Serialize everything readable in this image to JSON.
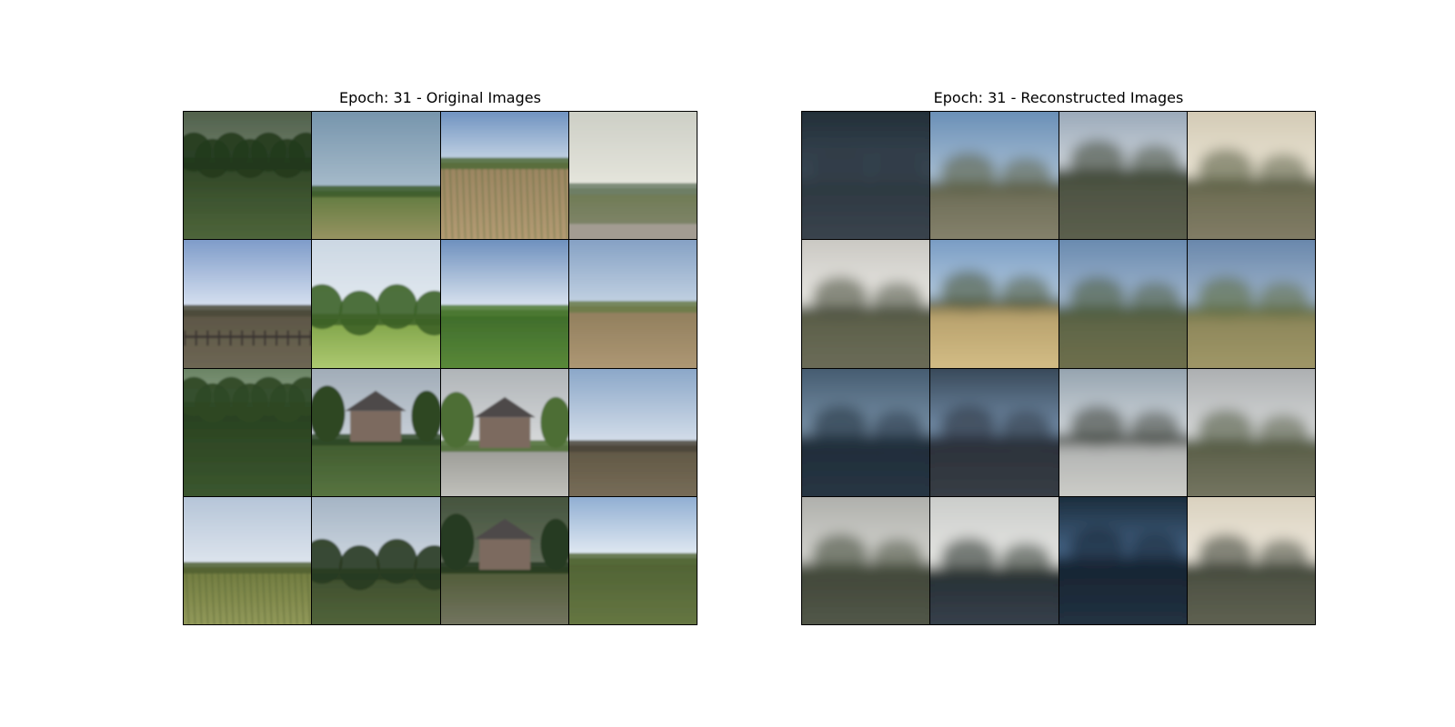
{
  "panels": [
    {
      "title": "Epoch: 31 - Original Images",
      "kind": "original",
      "tiles": [
        {
          "sky": [
            "#4a5a45",
            "#6f7f6a"
          ],
          "horizon": 0.4,
          "ground": [
            "#2f4526",
            "#536b3e"
          ],
          "band": "#243a1e",
          "scene": "woods"
        },
        {
          "sky": [
            "#6f8fa8",
            "#a8bccb"
          ],
          "horizon": 0.62,
          "ground": [
            "#5f7a3e",
            "#a59a6b"
          ],
          "band": "#3c5a2b",
          "scene": "field"
        },
        {
          "sky": [
            "#5b83b8",
            "#c6d5e5"
          ],
          "horizon": 0.4,
          "ground": [
            "#9a8460",
            "#b79f76"
          ],
          "band": "#4f6a37",
          "scene": "cornfield"
        },
        {
          "sky": [
            "#c9cbc2",
            "#e6e6dd"
          ],
          "horizon": 0.6,
          "ground": [
            "#6d7a52",
            "#8b8b78"
          ],
          "band": "#6f7f68",
          "scene": "road"
        },
        {
          "sky": [
            "#6e8fc2",
            "#dbe4f2"
          ],
          "horizon": 0.55,
          "ground": [
            "#5b5545",
            "#716a57"
          ],
          "band": "#4a4a3a",
          "scene": "fence"
        },
        {
          "sky": [
            "#c7d4e0",
            "#e6ecf2"
          ],
          "horizon": 0.62,
          "ground": [
            "#7fa348",
            "#b8d27a"
          ],
          "band": "#3d6228",
          "scene": "trees"
        },
        {
          "sky": [
            "#5a81b5",
            "#dfe7f1"
          ],
          "horizon": 0.55,
          "ground": [
            "#3d6a2a",
            "#5f8f3c"
          ],
          "band": "#4f7a33",
          "scene": "field"
        },
        {
          "sky": [
            "#7a98bf",
            "#c4d3e3"
          ],
          "horizon": 0.52,
          "ground": [
            "#8f7d5c",
            "#b39c78"
          ],
          "band": "#6a7b48",
          "scene": "field"
        },
        {
          "sky": [
            "#5f7a58",
            "#8ea289"
          ],
          "horizon": 0.3,
          "ground": [
            "#28401f",
            "#3e5a31"
          ],
          "band": "#2e4725",
          "scene": "woods"
        },
        {
          "sky": [
            "#9aa6b2",
            "#c8d0d8"
          ],
          "horizon": 0.55,
          "ground": [
            "#3f5a2e",
            "#5d7a45"
          ],
          "band": "#2d4624",
          "scene": "house"
        },
        {
          "sky": [
            "#a9aeb2",
            "#d8dadb"
          ],
          "horizon": 0.6,
          "ground": [
            "#9a9a95",
            "#c9c9c4"
          ],
          "band": "#4e6e34",
          "scene": "house"
        },
        {
          "sky": [
            "#7f9ec3",
            "#d7e0eb"
          ],
          "horizon": 0.6,
          "ground": [
            "#5f5644",
            "#7d725c"
          ],
          "band": "#4a4438",
          "scene": "field"
        },
        {
          "sky": [
            "#aebfd4",
            "#dfe6ee"
          ],
          "horizon": 0.55,
          "ground": [
            "#6f7a3e",
            "#9aa060"
          ],
          "band": "#4f5f30",
          "scene": "cornfield"
        },
        {
          "sky": [
            "#9daec0",
            "#d3dbe3"
          ],
          "horizon": 0.6,
          "ground": [
            "#3e4d2d",
            "#566a3e"
          ],
          "band": "#283a21",
          "scene": "trees"
        },
        {
          "sky": [
            "#3f4f38",
            "#66705e"
          ],
          "horizon": 0.55,
          "ground": [
            "#4f5a36",
            "#7a7a68"
          ],
          "band": "#263a20",
          "scene": "house"
        },
        {
          "sky": [
            "#7fa2cc",
            "#e6edf4"
          ],
          "horizon": 0.48,
          "ground": [
            "#4f6234",
            "#6a7a45"
          ],
          "band": "#566a3a",
          "scene": "field"
        }
      ]
    },
    {
      "title": "Epoch: 31 - Reconstructed Images",
      "kind": "reconstructed",
      "tiles": [
        {
          "sky": [
            "#1f2a33",
            "#3b4a57"
          ],
          "horizon": 0.55,
          "ground": [
            "#2c3640",
            "#3d4750"
          ],
          "band": "#303b44",
          "scene": "blur"
        },
        {
          "sky": [
            "#5f87b2",
            "#aec3d6"
          ],
          "horizon": 0.58,
          "ground": [
            "#6b6b55",
            "#8a8670"
          ],
          "band": "#5a5f45",
          "scene": "blur"
        },
        {
          "sky": [
            "#8fa0b2",
            "#d2d8de"
          ],
          "horizon": 0.48,
          "ground": [
            "#4a5040",
            "#5f6250"
          ],
          "band": "#3f4838",
          "scene": "blur"
        },
        {
          "sky": [
            "#cfc6b0",
            "#ece6d6"
          ],
          "horizon": 0.55,
          "ground": [
            "#6a6a50",
            "#86806a"
          ],
          "band": "#5a5f45",
          "scene": "blur"
        },
        {
          "sky": [
            "#c4c2bd",
            "#ecebe6"
          ],
          "horizon": 0.55,
          "ground": [
            "#5a5e48",
            "#6e6e5a"
          ],
          "band": "#4b5040",
          "scene": "blur"
        },
        {
          "sky": [
            "#6d93bf",
            "#b8cde0"
          ],
          "horizon": 0.5,
          "ground": [
            "#b39c68",
            "#d8c28a"
          ],
          "band": "#4a5538",
          "scene": "blur"
        },
        {
          "sky": [
            "#5f82aa",
            "#a6bad0"
          ],
          "horizon": 0.55,
          "ground": [
            "#5a6244",
            "#72724f"
          ],
          "band": "#4b5a3c",
          "scene": "blur"
        },
        {
          "sky": [
            "#5f7fa6",
            "#a4b8cd"
          ],
          "horizon": 0.55,
          "ground": [
            "#8a8458",
            "#a39a6a"
          ],
          "band": "#5c6a40",
          "scene": "blur"
        },
        {
          "sky": [
            "#3c5266",
            "#7d96ad"
          ],
          "horizon": 0.55,
          "ground": [
            "#1e2b38",
            "#2a3846"
          ],
          "band": "#233240",
          "scene": "blur"
        },
        {
          "sky": [
            "#2d3c4a",
            "#7a95b2"
          ],
          "horizon": 0.55,
          "ground": [
            "#2a3038",
            "#3a4048"
          ],
          "band": "#2b3440",
          "scene": "blur"
        },
        {
          "sky": [
            "#8a9aa7",
            "#d6dbdf"
          ],
          "horizon": 0.55,
          "ground": [
            "#aeb0b0",
            "#d2d2cc"
          ],
          "band": "#3a4038",
          "scene": "blur"
        },
        {
          "sky": [
            "#a5a8aa",
            "#dadcdc"
          ],
          "horizon": 0.58,
          "ground": [
            "#5a5e48",
            "#7a7a66"
          ],
          "band": "#525a42",
          "scene": "blur"
        },
        {
          "sky": [
            "#a8a9a5",
            "#d7d7d2"
          ],
          "horizon": 0.55,
          "ground": [
            "#3f4538",
            "#565b4c"
          ],
          "band": "#454c3c",
          "scene": "blur"
        },
        {
          "sky": [
            "#c6c8c6",
            "#e9e9e6"
          ],
          "horizon": 0.58,
          "ground": [
            "#262e34",
            "#3a4450"
          ],
          "band": "#2d3630",
          "scene": "blur"
        },
        {
          "sky": [
            "#12202c",
            "#4a6c90"
          ],
          "horizon": 0.5,
          "ground": [
            "#162330",
            "#243444"
          ],
          "band": "#1a2838",
          "scene": "blur"
        },
        {
          "sky": [
            "#d6cdb9",
            "#f0ebe0"
          ],
          "horizon": 0.55,
          "ground": [
            "#4a4e40",
            "#636555"
          ],
          "band": "#3f4538",
          "scene": "blur"
        }
      ]
    }
  ]
}
